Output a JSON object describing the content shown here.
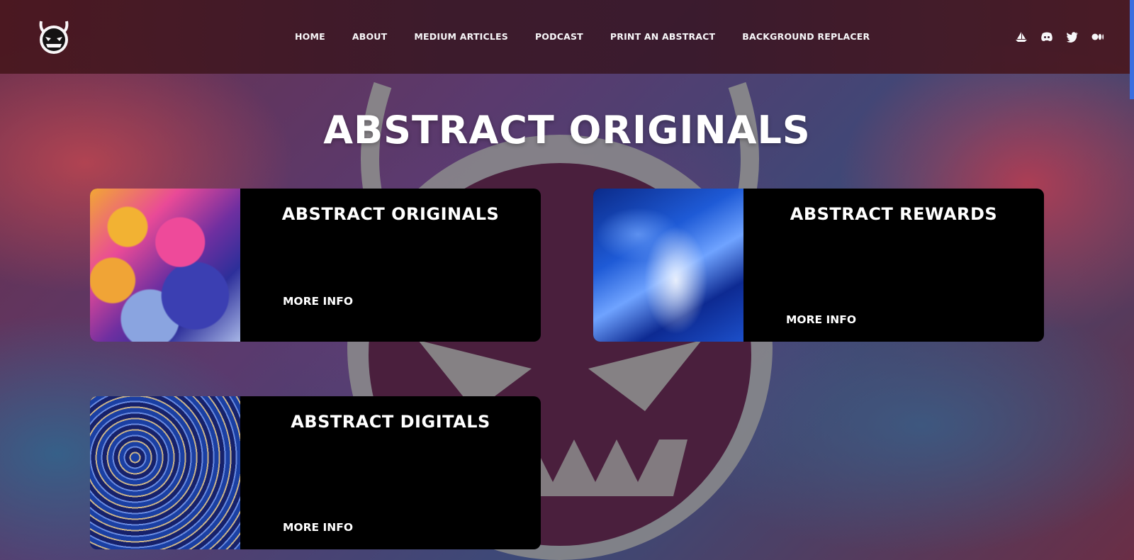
{
  "nav": {
    "items": [
      "HOME",
      "ABOUT",
      "MEDIUM ARTICLES",
      "PODCAST",
      "PRINT AN ABSTRACT",
      "BACKGROUND REPLACER"
    ]
  },
  "socials": [
    "opensea-icon",
    "discord-icon",
    "twitter-icon",
    "medium-icon"
  ],
  "page": {
    "title": "ABSTRACT ORIGINALS"
  },
  "cards": [
    {
      "title": "ABSTRACT ORIGINALS",
      "more": "MORE INFO"
    },
    {
      "title": "ABSTRACT REWARDS",
      "more": "MORE INFO"
    },
    {
      "title": "ABSTRACT DIGITALS",
      "more": "MORE INFO"
    }
  ],
  "colors": {
    "header_bg": "#3b1a2a",
    "card_bg": "#000000",
    "text": "#ffffff",
    "scroll_accent": "#3a6fe0"
  }
}
